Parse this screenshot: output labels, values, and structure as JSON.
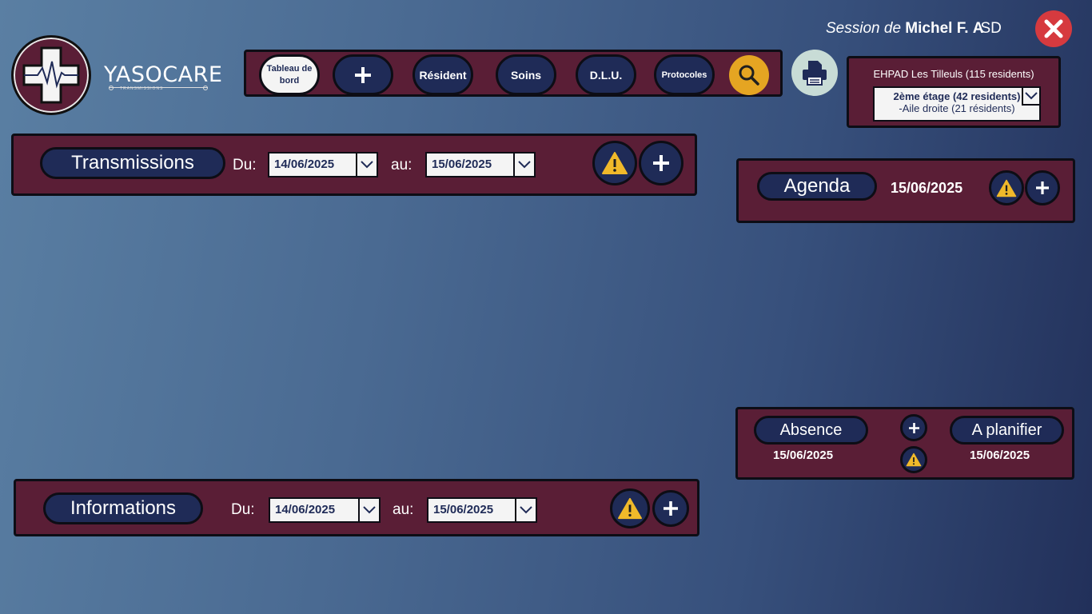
{
  "brand": {
    "name": "YASOCARE",
    "subtitle": "TRANSMISSIONS"
  },
  "nav": {
    "dashboard_label": "Tableau de bord",
    "add_label": "+",
    "resident_label": "Résident",
    "soins_label": "Soins",
    "dlu_label": "D.L.U.",
    "protocoles_label": "Protocoles"
  },
  "session": {
    "prefix": "Session de",
    "user": "Michel F.",
    "role_first": "A",
    "role_rest": "SD"
  },
  "establishment": {
    "title": "EHPAD Les Tilleuls (115 residents)",
    "selected_line1": "2ème étage (42 residents)",
    "selected_line2": "-Aile droite (21 résidents)"
  },
  "transmissions": {
    "title": "Transmissions",
    "from_label": "Du:",
    "from_value": "14/06/2025",
    "to_label": "au:",
    "to_value": "15/06/2025"
  },
  "informations": {
    "title": "Informations",
    "from_label": "Du:",
    "from_value": "14/06/2025",
    "to_label": "au:",
    "to_value": "15/06/2025"
  },
  "agenda": {
    "title": "Agenda",
    "date": "15/06/2025"
  },
  "absence": {
    "title": "Absence",
    "date": "15/06/2025"
  },
  "planifier": {
    "title": "A planifier",
    "date": "15/06/2025"
  },
  "colors": {
    "panel": "#5a1e36",
    "navy": "#1f2b57",
    "warning": "#f0b92a",
    "close": "#d63a3f",
    "search": "#e5a522"
  },
  "icons": [
    "cross-logo-icon",
    "plus-icon",
    "search-icon",
    "printer-icon",
    "close-icon",
    "warning-icon",
    "chevron-down-icon"
  ]
}
